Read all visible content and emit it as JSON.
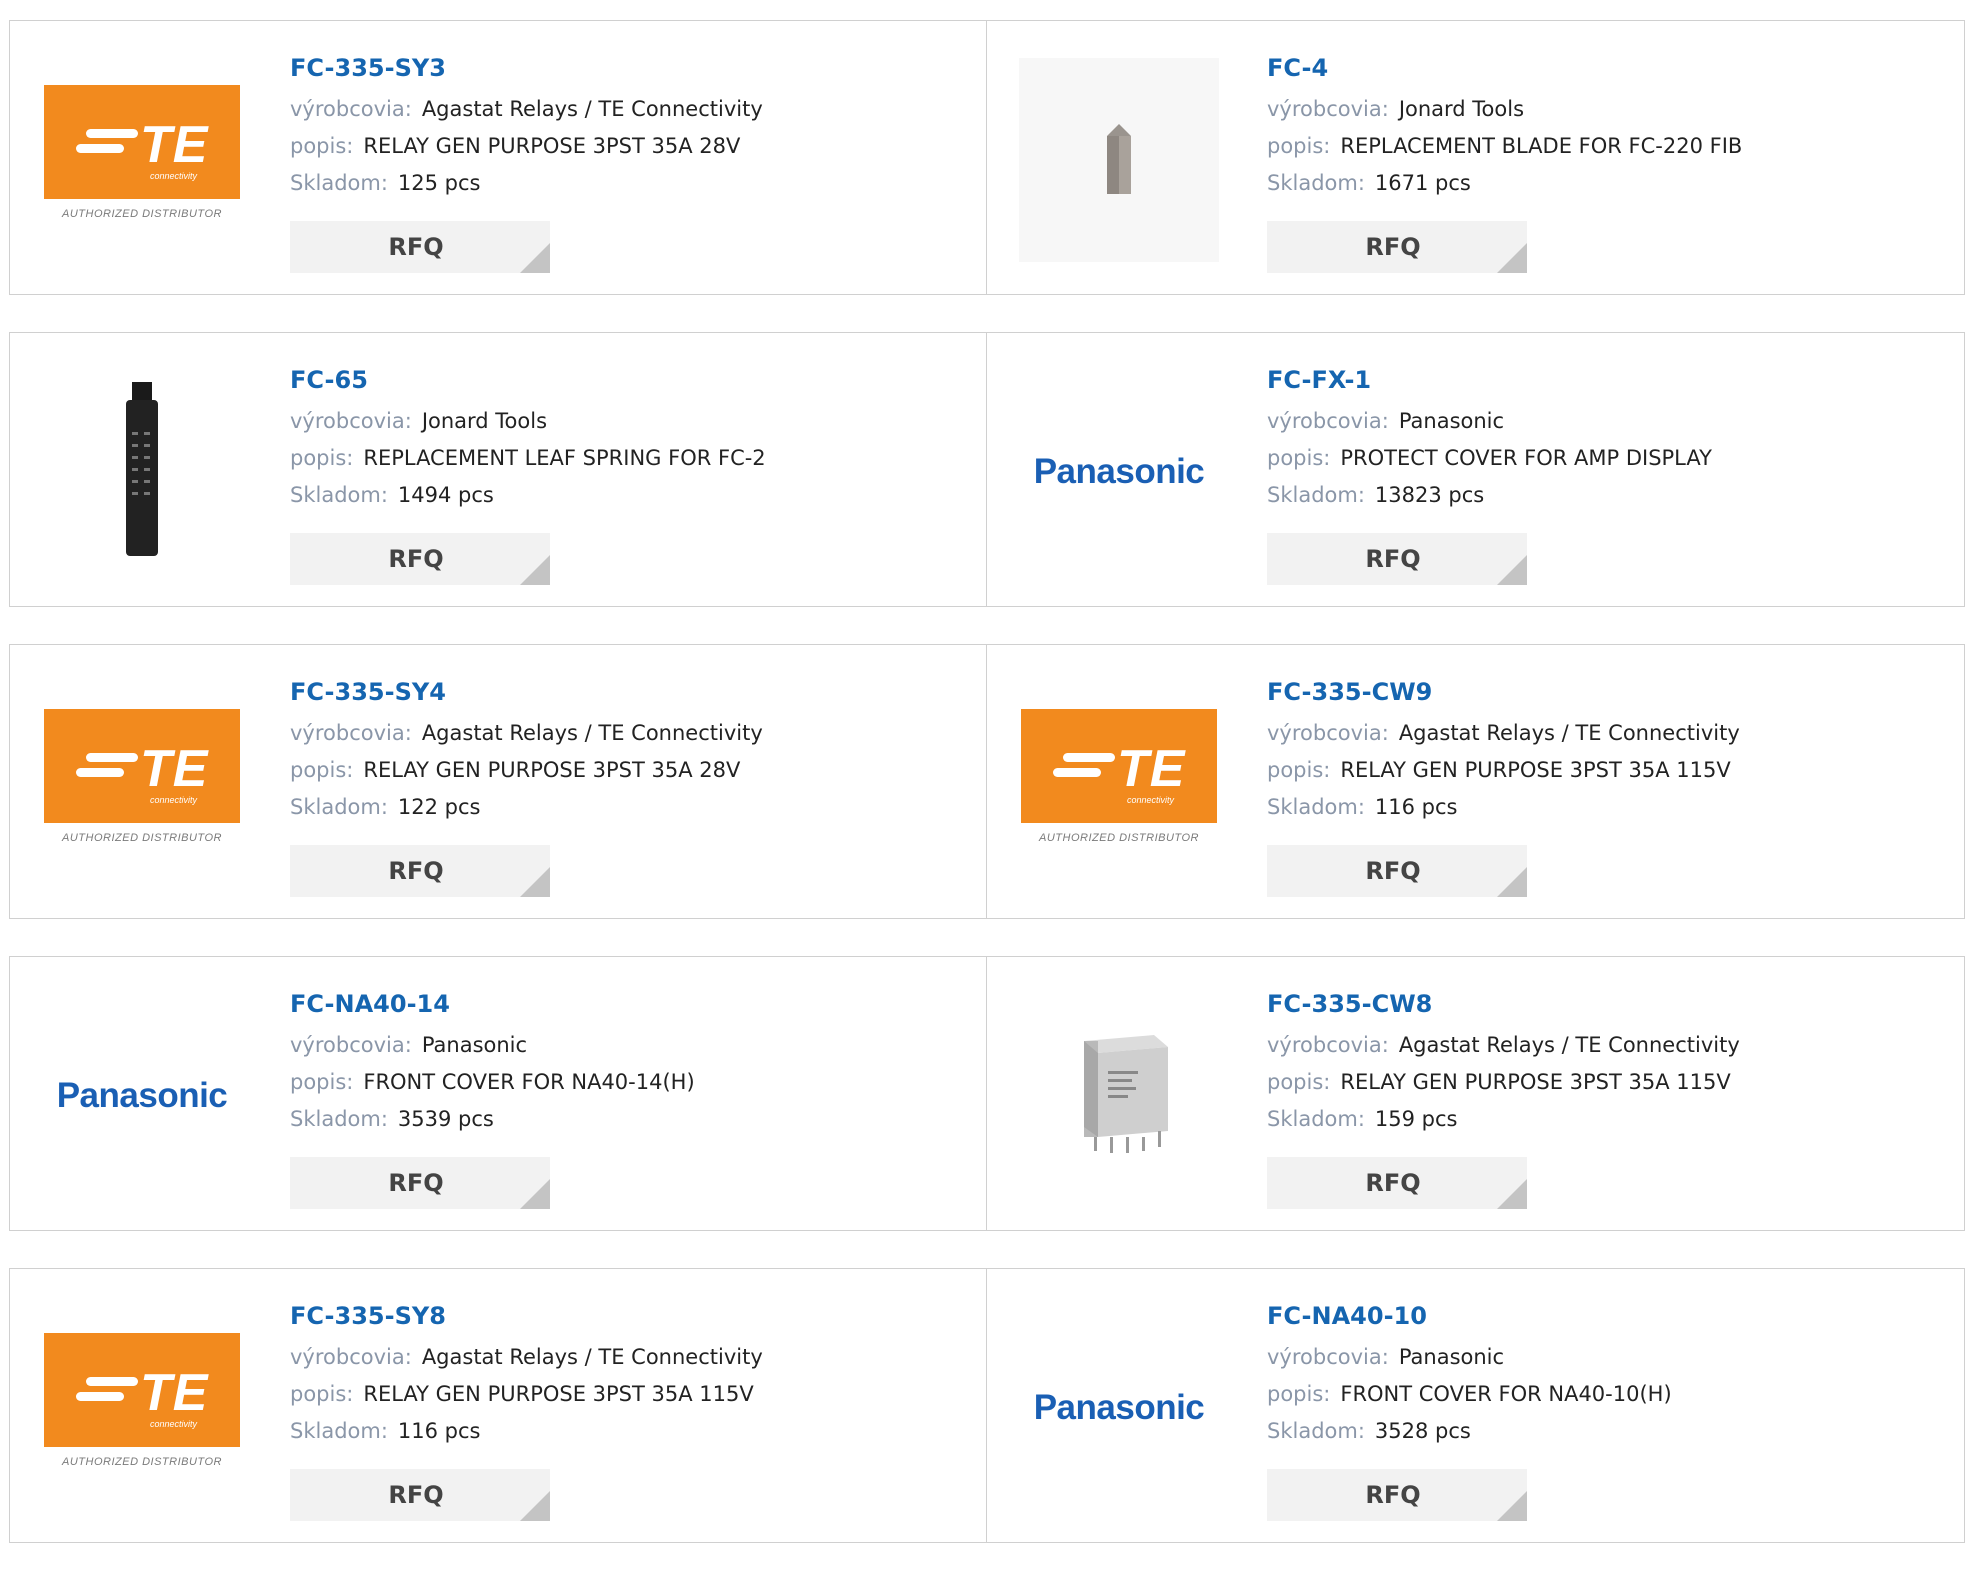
{
  "labels": {
    "manufacturer": "výrobcovia:",
    "description": "popis:",
    "stock": "Skladom:",
    "rfq": "RFQ"
  },
  "logos": {
    "te_word": "TE",
    "te_sub": "connectivity",
    "te_footer": "AUTHORIZED DISTRIBUTOR",
    "panasonic": "Panasonic"
  },
  "colors": {
    "part_link": "#1565b0",
    "te_orange": "#f28a1e",
    "panasonic_blue": "#1a5fb4"
  },
  "products": [
    {
      "part": "FC-335-SY3",
      "manufacturer": "Agastat Relays / TE Connectivity",
      "description": "RELAY GEN PURPOSE 3PST 35A 28V",
      "stock": "125 pcs",
      "image": "te-logo"
    },
    {
      "part": "FC-4",
      "manufacturer": "Jonard Tools",
      "description": "REPLACEMENT BLADE FOR FC-220 FIB",
      "stock": "1671 pcs",
      "image": "blade-photo"
    },
    {
      "part": "FC-65",
      "manufacturer": "Jonard Tools",
      "description": "REPLACEMENT LEAF SPRING FOR FC-2",
      "stock": "1494 pcs",
      "image": "spring-photo"
    },
    {
      "part": "FC-FX-1",
      "manufacturer": "Panasonic",
      "description": "PROTECT COVER FOR AMP DISPLAY",
      "stock": "13823 pcs",
      "image": "panasonic-logo"
    },
    {
      "part": "FC-335-SY4",
      "manufacturer": "Agastat Relays / TE Connectivity",
      "description": "RELAY GEN PURPOSE 3PST 35A 28V",
      "stock": "122 pcs",
      "image": "te-logo"
    },
    {
      "part": "FC-335-CW9",
      "manufacturer": "Agastat Relays / TE Connectivity",
      "description": "RELAY GEN PURPOSE 3PST 35A 115V",
      "stock": "116 pcs",
      "image": "te-logo"
    },
    {
      "part": "FC-NA40-14",
      "manufacturer": "Panasonic",
      "description": "FRONT COVER FOR NA40-14(H)",
      "stock": "3539 pcs",
      "image": "panasonic-logo"
    },
    {
      "part": "FC-335-CW8",
      "manufacturer": "Agastat Relays / TE Connectivity",
      "description": "RELAY GEN PURPOSE 3PST 35A 115V",
      "stock": "159 pcs",
      "image": "relay-photo"
    },
    {
      "part": "FC-335-SY8",
      "manufacturer": "Agastat Relays / TE Connectivity",
      "description": "RELAY GEN PURPOSE 3PST 35A 115V",
      "stock": "116 pcs",
      "image": "te-logo"
    },
    {
      "part": "FC-NA40-10",
      "manufacturer": "Panasonic",
      "description": "FRONT COVER FOR NA40-10(H)",
      "stock": "3528 pcs",
      "image": "panasonic-logo"
    }
  ]
}
